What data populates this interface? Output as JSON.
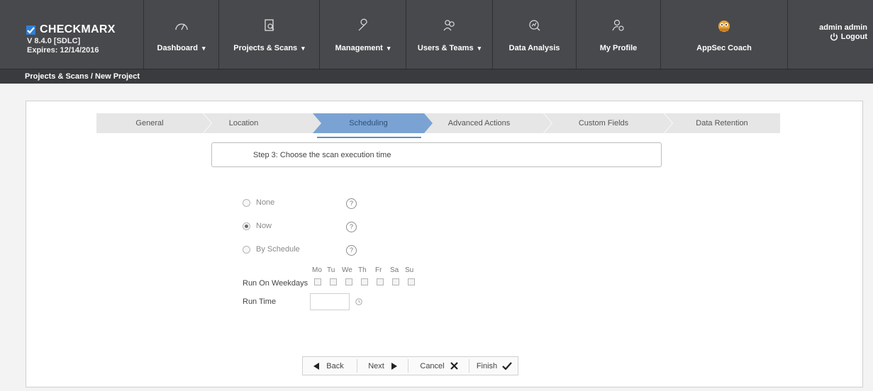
{
  "brand": {
    "name": "CHECKMARX",
    "version": "V 8.4.0  [SDLC]",
    "expires": "Expires: 12/14/2016"
  },
  "nav": {
    "items": [
      {
        "label": "Dashboard",
        "icon": "gauge-icon",
        "has_caret": true
      },
      {
        "label": "Projects & Scans",
        "icon": "projects-icon",
        "has_caret": true
      },
      {
        "label": "Management",
        "icon": "wrench-icon",
        "has_caret": true
      },
      {
        "label": "Users & Teams",
        "icon": "users-icon",
        "has_caret": true
      },
      {
        "label": "Data Analysis",
        "icon": "data-analysis-icon",
        "has_caret": false
      },
      {
        "label": "My Profile",
        "icon": "profile-gear-icon",
        "has_caret": false
      },
      {
        "label": "AppSec Coach",
        "icon": "owl-icon",
        "has_caret": false
      }
    ],
    "caret": "▾"
  },
  "user": {
    "name": "admin admin",
    "logout_label": "Logout"
  },
  "breadcrumb": "Projects & Scans / New Project",
  "wizard": {
    "steps": [
      "General",
      "Location",
      "Scheduling",
      "Advanced Actions",
      "Custom Fields",
      "Data Retention"
    ],
    "active_index": 2,
    "step_title": "Step 3: Choose the scan execution time"
  },
  "schedule": {
    "options": [
      {
        "label": "None",
        "checked": false
      },
      {
        "label": "Now",
        "checked": true
      },
      {
        "label": "By Schedule",
        "checked": false
      }
    ],
    "help_glyph": "?",
    "weekdays_label": "Run On Weekdays",
    "days": [
      "Mo",
      "Tu",
      "We",
      "Th",
      "Fr",
      "Sa",
      "Su"
    ],
    "run_time_label": "Run Time",
    "run_time_value": ""
  },
  "buttons": {
    "back": "Back",
    "next": "Next",
    "cancel": "Cancel",
    "finish": "Finish"
  },
  "colors": {
    "nav_bg": "#48494c",
    "active_step": "#7aa3d3",
    "inactive_step": "#e6e6e6"
  }
}
